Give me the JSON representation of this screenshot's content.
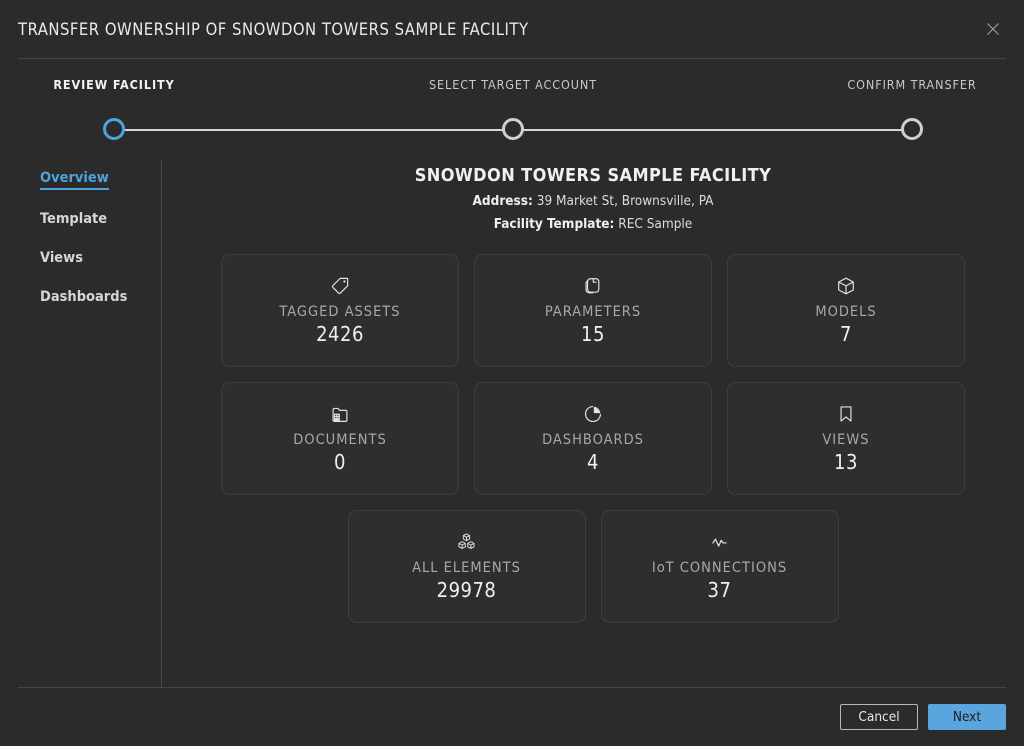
{
  "header": {
    "title": "TRANSFER OWNERSHIP OF SNOWDON TOWERS SAMPLE FACILITY",
    "close_icon": "close-icon"
  },
  "stepper": {
    "active_index": 0,
    "steps": [
      {
        "label": "REVIEW FACILITY",
        "state": "active"
      },
      {
        "label": "SELECT TARGET ACCOUNT",
        "state": "inactive"
      },
      {
        "label": "CONFIRM TRANSFER",
        "state": "inactive"
      }
    ]
  },
  "sidebar": {
    "items": [
      {
        "label": "Overview",
        "active": true
      },
      {
        "label": "Template",
        "active": false
      },
      {
        "label": "Views",
        "active": false
      },
      {
        "label": "Dashboards",
        "active": false
      }
    ]
  },
  "facility": {
    "name": "SNOWDON TOWERS SAMPLE FACILITY",
    "address_label": "Address:",
    "address_value": "39 Market St, Brownsville, PA",
    "template_label": "Facility Template:",
    "template_value": "REC Sample"
  },
  "cards": [
    [
      {
        "icon": "tag-icon",
        "label": "TAGGED ASSETS",
        "value": "2426"
      },
      {
        "icon": "copy-pages-icon",
        "label": "PARAMETERS",
        "value": "15"
      },
      {
        "icon": "cube-icon",
        "label": "MODELS",
        "value": "7"
      }
    ],
    [
      {
        "icon": "folder-building-icon",
        "label": "DOCUMENTS",
        "value": "0"
      },
      {
        "icon": "pie-chart-icon",
        "label": "DASHBOARDS",
        "value": "4"
      },
      {
        "icon": "bookmark-icon",
        "label": "VIEWS",
        "value": "13"
      }
    ],
    [
      {
        "icon": "stacked-boxes-icon",
        "label": "ALL ELEMENTS",
        "value": "29978"
      },
      {
        "icon": "activity-pulse-icon",
        "label": "IoT CONNECTIONS",
        "value": "37"
      }
    ]
  ],
  "footer": {
    "cancel_label": "Cancel",
    "next_label": "Next"
  },
  "colors": {
    "accent_blue": "#5aa5dd",
    "modal_bg": "#2b2b2b",
    "card_bg": "#2e2e2e",
    "card_border": "#3f3f3f",
    "divider": "#444444",
    "text_primary": "#f0f0f0",
    "text_muted": "#a8a8a8"
  }
}
